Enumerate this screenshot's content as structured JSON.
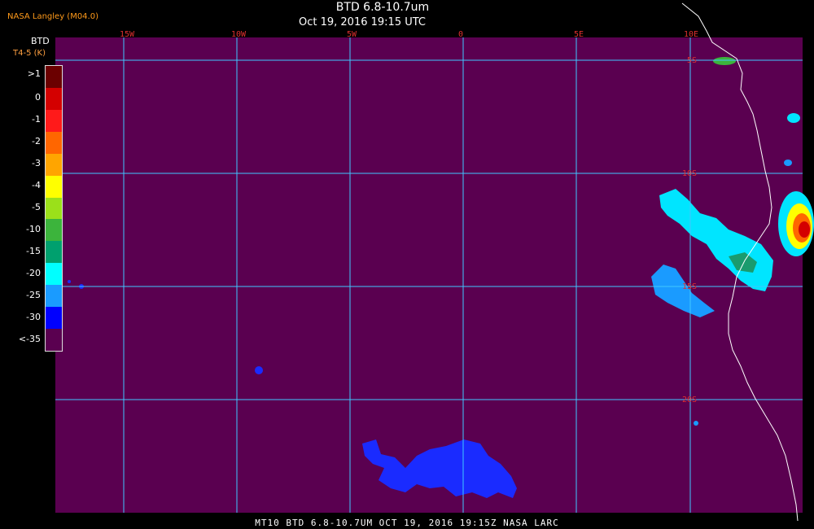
{
  "header": {
    "agency": "NASA Langley (M04.0)",
    "title": "BTD 6.8-10.7um",
    "subtitle": "Oct 19, 2016 19:15 UTC"
  },
  "colorbar": {
    "title": "BTD",
    "units": "T4-5 (K)",
    "labels": [
      ">1",
      "0",
      "-1",
      "-2",
      "-3",
      "-4",
      "-5",
      "-10",
      "-15",
      "-20",
      "-25",
      "-30",
      "<-35"
    ],
    "colors": [
      "#6b0000",
      "#d40000",
      "#ff1a1a",
      "#ff6600",
      "#ffa500",
      "#ffff00",
      "#9be01a",
      "#3cb43c",
      "#00a06e",
      "#00ffff",
      "#1a9bff",
      "#0000ff",
      "#5a0050"
    ]
  },
  "map": {
    "background_color": "#5a0050",
    "grid_color": "#40c8ff",
    "label_color": "#e03030",
    "longitude_labels": [
      "15W",
      "10W",
      "5W",
      "0",
      "5E",
      "10E"
    ],
    "latitude_labels": [
      "5S",
      "10S",
      "15S",
      "20S"
    ]
  },
  "footer": {
    "text": "MT10  BTD 6.8-10.7UM   OCT 19, 2016 19:15Z   NASA LARC"
  }
}
